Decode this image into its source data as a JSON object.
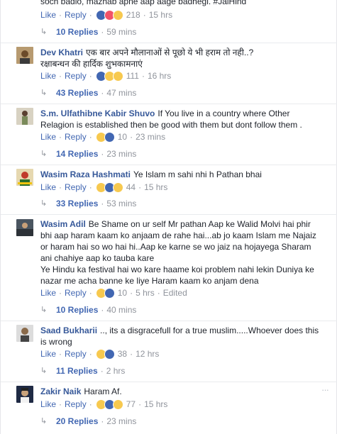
{
  "top": {
    "partial_text": "soch badlo, mazhab apne aap aage badhegi. #JaiHind",
    "like": "Like",
    "reply": "Reply",
    "reaction_count": "218",
    "time": "15 hrs",
    "replies_label": "10 Replies",
    "replies_time": "59 mins"
  },
  "comments": [
    {
      "author": "Dev Khatri",
      "text_lines": [
        "एक बार अपने मौलानाओं से पूछो ये भी हराम तो नही..?",
        "रक्षाबन्धन की हार्दिक शुभकामनाएं"
      ],
      "like": "Like",
      "reply": "Reply",
      "reaction_count": "111",
      "time": "16 hrs",
      "replies_label": "43 Replies",
      "replies_time": "47 mins",
      "reaction_icons": [
        "like-reaction-icon",
        "haha-reaction-icon",
        "wow-reaction-icon"
      ]
    },
    {
      "author": "S.m. Ulfathibne Kabir Shuvo",
      "text_lines": [
        "If You live in a country where Other",
        "Relagion is established then be good with them but dont follow them ."
      ],
      "like": "Like",
      "reply": "Reply",
      "reaction_count": "10",
      "time": "23 mins",
      "replies_label": "14 Replies",
      "replies_time": "23 mins",
      "reaction_icons": [
        "haha-reaction-icon",
        "like-reaction-icon"
      ]
    },
    {
      "author": "Wasim Raza Hashmati",
      "text_lines": [
        "Ye Islam m sahi nhi h Pathan bhai"
      ],
      "like": "Like",
      "reply": "Reply",
      "reaction_count": "44",
      "time": "15 hrs",
      "replies_label": "33 Replies",
      "replies_time": "53 mins",
      "reaction_icons": [
        "haha-reaction-icon",
        "like-reaction-icon",
        "sad-reaction-icon"
      ]
    },
    {
      "author": "Wasim Adil",
      "text_lines": [
        "Be Shame on ur self Mr pathan Aap ke Walid Molvi hai phir",
        "bhi aap haram kaam ko anjaam de rahe hai...ab jo kaam Islam me Najaiz",
        "or haram hai so wo hai hi..Aap ke karne se wo jaiz na hojayega Sharam",
        "ani chahiye aap ko tauba kare",
        "Ye Hindu ka festival hai wo kare haame koi problem nahi lekin Duniya ke",
        "nazar me acha banne ke liye Haram kaam ko anjam dena"
      ],
      "like": "Like",
      "reply": "Reply",
      "reaction_count": "10",
      "time": "5 hrs",
      "edited": "Edited",
      "replies_label": "10 Replies",
      "replies_time": "40 mins",
      "reaction_icons": [
        "haha-reaction-icon",
        "like-reaction-icon"
      ]
    },
    {
      "author": "Saad Bukharii",
      "text_lines": ".., its a disgracefull for a true muslim.....Whoever does this|is wrong",
      "like": "Like",
      "reply": "Reply",
      "reaction_count": "38",
      "time": "12 hrs",
      "replies_label": "11 Replies",
      "replies_time": "2 hrs",
      "reaction_icons": [
        "haha-reaction-icon",
        "like-reaction-icon"
      ]
    },
    {
      "author": "Zakir Naik",
      "text_lines": [
        "Haram Af."
      ],
      "like": "Like",
      "reply": "Reply",
      "reaction_count": "77",
      "time": "15 hrs",
      "replies_label": "20 Replies",
      "replies_time": "23 mins",
      "reaction_icons": [
        "haha-reaction-icon",
        "like-reaction-icon",
        "sad-reaction-icon"
      ]
    }
  ],
  "options_glyph": "···",
  "colors": {
    "link": "#365899",
    "action": "#4267b2",
    "meta": "#90949c",
    "text": "#1d2129"
  }
}
